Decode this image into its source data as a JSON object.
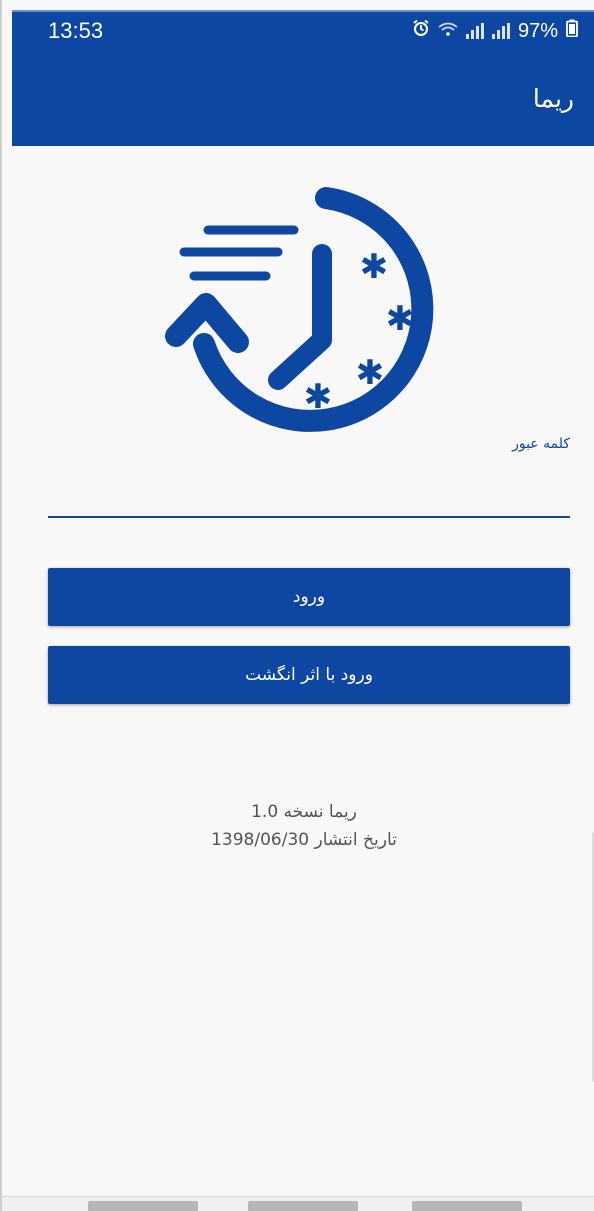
{
  "status_bar": {
    "time": "13:53",
    "battery_text": "97%",
    "icons": [
      "alarm-icon",
      "wifi-icon",
      "signal-icon",
      "signal-icon",
      "battery-icon"
    ]
  },
  "app_bar": {
    "title": "ریما"
  },
  "logo": {
    "icon": "clock-history-icon",
    "color": "#0d47a1"
  },
  "form": {
    "password_label": "کلمه عبور",
    "password_value": "",
    "login_button": "ورود",
    "fingerprint_button": "ورود با اثر انگشت"
  },
  "footer": {
    "version_line": "ریما نسخه 1.0",
    "release_line": "تاریخ انتشار 1398/06/30"
  },
  "theme": {
    "primary": "#0d47a1",
    "background": "#f8f8f8"
  }
}
